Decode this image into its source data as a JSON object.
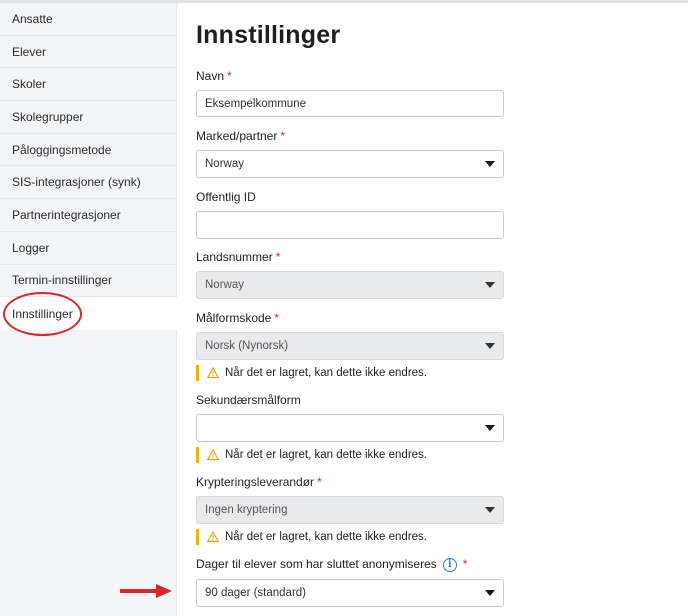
{
  "sidebar": {
    "items": [
      {
        "label": "Ansatte"
      },
      {
        "label": "Elever"
      },
      {
        "label": "Skoler"
      },
      {
        "label": "Skolegrupper"
      },
      {
        "label": "Påloggingsmetode"
      },
      {
        "label": "SIS-integrasjoner (synk)"
      },
      {
        "label": "Partnerintegrasjoner"
      },
      {
        "label": "Logger"
      },
      {
        "label": "Termin-innstillinger"
      },
      {
        "label": "Innstillinger"
      }
    ],
    "active": "Innstillinger"
  },
  "main": {
    "title": "Innstillinger",
    "fields": {
      "name": {
        "label": "Navn",
        "required": "*",
        "value": "Eksempelkommune"
      },
      "market": {
        "label": "Marked/partner",
        "required": "*",
        "value": "Norway"
      },
      "public_id": {
        "label": "Offentlig ID",
        "value": ""
      },
      "country": {
        "label": "Landsnummer",
        "required": "*",
        "value": "Norway"
      },
      "language": {
        "label": "Målformskode",
        "required": "*",
        "value": "Norsk (Nynorsk)",
        "warning": "Når det er lagret, kan dette ikke endres."
      },
      "secondary_language": {
        "label": "Sekundærsmålform",
        "value": "",
        "warning": "Når det er lagret, kan dette ikke endres."
      },
      "encryption": {
        "label": "Krypteringsleverandør",
        "required": "*",
        "value": "Ingen kryptering",
        "warning": "Når det er lagret, kan dette ikke endres."
      },
      "anonymize": {
        "label": "Dager til elever som har sluttet anonymiseres",
        "required": "*",
        "value": "90 dager (standard)"
      }
    }
  },
  "colors": {
    "required": "#d9262a",
    "warning_bar": "#f0b400",
    "annotation": "#d9262a",
    "info": "#2f7dd1"
  },
  "icons": [
    "warning-icon",
    "info-icon",
    "chevron-down-icon",
    "annotation-arrow"
  ]
}
